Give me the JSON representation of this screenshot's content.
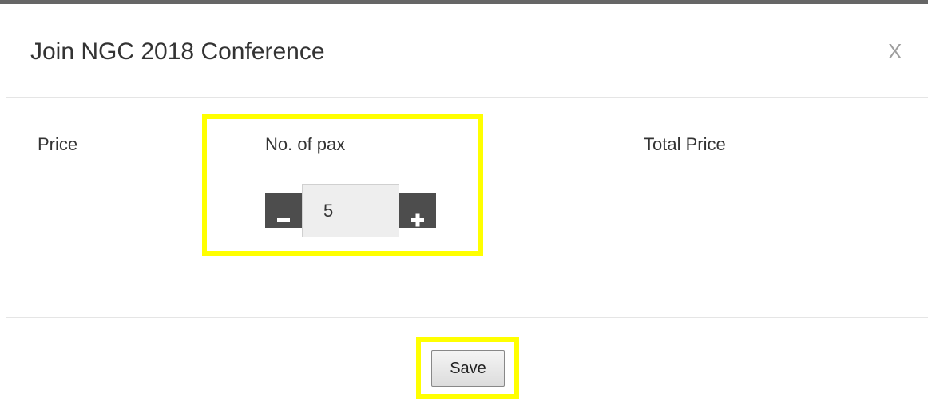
{
  "modal": {
    "title": "Join NGC 2018 Conference",
    "close_label": "X"
  },
  "form": {
    "price_label": "Price",
    "pax_label": "No. of pax",
    "total_label": "Total Price",
    "pax": {
      "value": "5",
      "minus_icon": "minus-icon",
      "plus_icon": "plus-icon"
    }
  },
  "footer": {
    "save_label": "Save"
  },
  "colors": {
    "highlight": "#ffff00",
    "stepper_button": "#4d4d4d"
  }
}
